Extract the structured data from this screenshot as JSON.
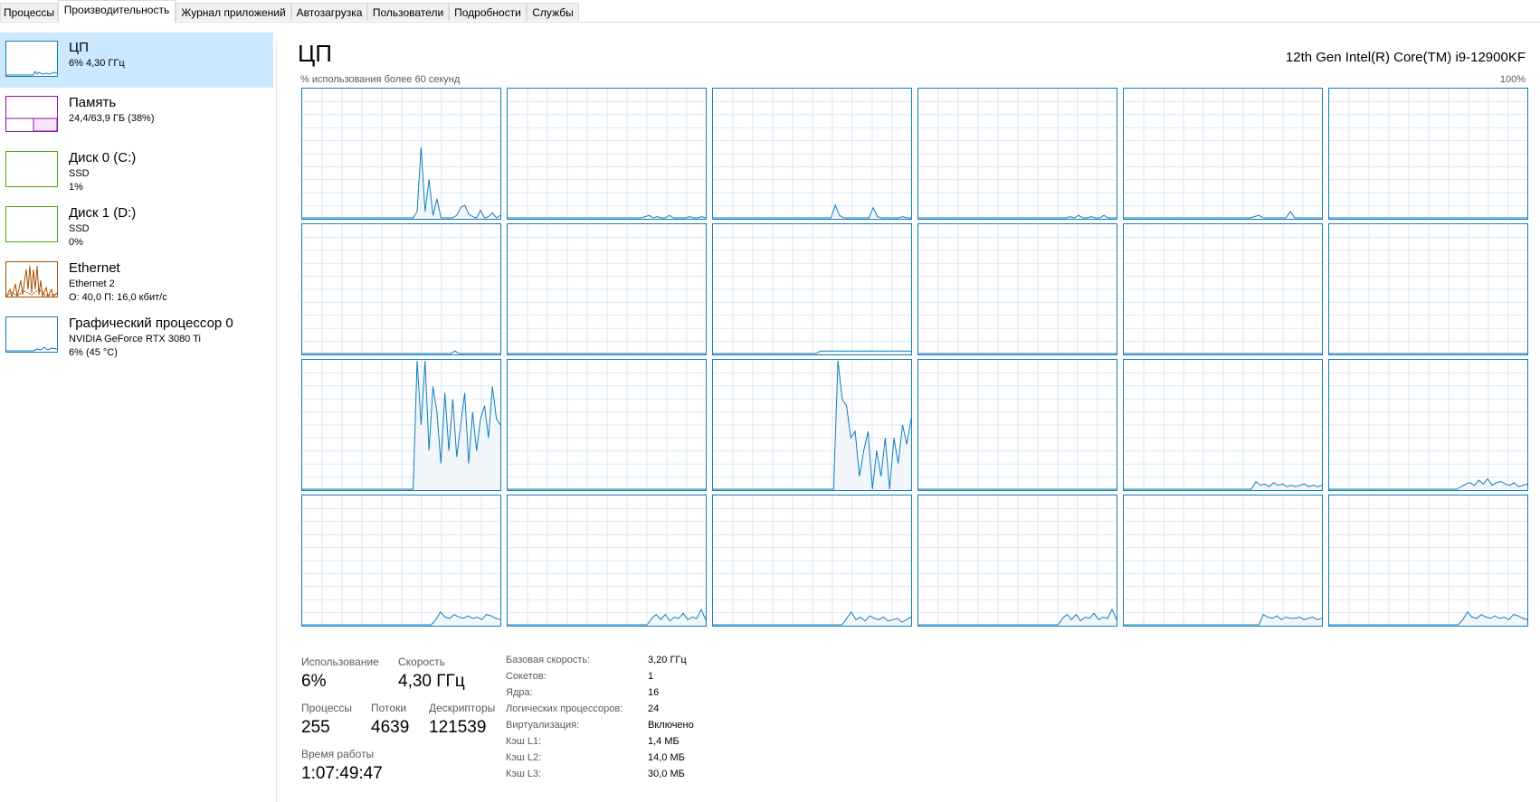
{
  "tabs": [
    "Процессы",
    "Производительность",
    "Журнал приложений",
    "Автозагрузка",
    "Пользователи",
    "Подробности",
    "Службы"
  ],
  "sidebar": {
    "items": [
      {
        "title": "ЦП",
        "line1": "6% 4,30 ГГц",
        "line2": "",
        "color": "#117dbb"
      },
      {
        "title": "Память",
        "line1": "24,4/63,9 ГБ (38%)",
        "line2": "",
        "color": "#8b12ae"
      },
      {
        "title": "Диск 0 (C:)",
        "line1": "SSD",
        "line2": "1%",
        "color": "#4da60c"
      },
      {
        "title": "Диск 1 (D:)",
        "line1": "SSD",
        "line2": "0%",
        "color": "#4da60c"
      },
      {
        "title": "Ethernet",
        "line1": "Ethernet 2",
        "line2": "О: 40,0 П: 16,0 кбит/с",
        "color": "#a74f01"
      },
      {
        "title": "Графический процессор 0",
        "line1": "NVIDIA GeForce RTX 3080 Ti",
        "line2": "6% (45 °C)",
        "color": "#117dbb"
      }
    ]
  },
  "main": {
    "title": "ЦП",
    "cpu_name": "12th Gen Intel(R) Core(TM) i9-12900KF",
    "axis_left": "% использования более 60 секунд",
    "axis_right": "100%",
    "graph_color": "#117dbb"
  },
  "stats": {
    "usage_label": "Использование",
    "usage_value": "6%",
    "speed_label": "Скорость",
    "speed_value": "4,30 ГГц",
    "processes_label": "Процессы",
    "processes_value": "255",
    "threads_label": "Потоки",
    "threads_value": "4639",
    "handles_label": "Дескрипторы",
    "handles_value": "121539",
    "uptime_label": "Время работы",
    "uptime_value": "1:07:49:47"
  },
  "properties": [
    {
      "label": "Базовая скорость:",
      "value": "3,20 ГГц"
    },
    {
      "label": "Сокетов:",
      "value": "1"
    },
    {
      "label": "Ядра:",
      "value": "16"
    },
    {
      "label": "Логических процессоров:",
      "value": "24"
    },
    {
      "label": "Виртуализация:",
      "value": "Включено"
    },
    {
      "label": "Кэш L1:",
      "value": "1,4 МБ"
    },
    {
      "label": "Кэш L2:",
      "value": "14,0 МБ"
    },
    {
      "label": "Кэш L3:",
      "value": "30,0 МБ"
    }
  ]
}
